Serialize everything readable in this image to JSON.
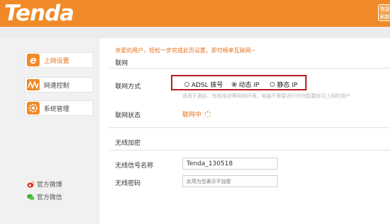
{
  "header": {
    "logo": "Tenda",
    "corner_button": "恢复\n刷新"
  },
  "sidebar": {
    "items": [
      {
        "label": "上网设置",
        "icon": "internet-e-icon",
        "active": true
      },
      {
        "label": "网速控制",
        "icon": "speed-wave-icon",
        "active": false
      },
      {
        "label": "系统管理",
        "icon": "gear-icon",
        "active": false
      }
    ],
    "social": [
      {
        "label": "官方微博",
        "icon": "weibo-icon"
      },
      {
        "label": "官方微信",
        "icon": "wechat-icon"
      }
    ]
  },
  "main": {
    "welcome": "亲爱的用户，轻松一步完成此页设置，即可畅享互联网~",
    "section_internet": "联网",
    "conn_mode_label": "联网方式",
    "options": [
      {
        "label": "ADSL 拨号",
        "selected": false
      },
      {
        "label": "动态 IP",
        "selected": true
      },
      {
        "label": "静态 IP",
        "selected": false
      }
    ],
    "hint": "适用于酒店、有线电视等网络环境，电脑不需要进行任何配置就可上网的用户",
    "status_label": "联网状态",
    "status_value": "联网中",
    "section_wireless": "无线加密",
    "ssid_label": "无线信号名称",
    "ssid_value": "Tenda_130518",
    "pwd_label": "无线密码",
    "pwd_placeholder": "此项为空表示不加密"
  },
  "colors": {
    "brand_orange": "#f08a28",
    "accent_text": "#e8701a",
    "highlight_red": "#b81c1c"
  }
}
